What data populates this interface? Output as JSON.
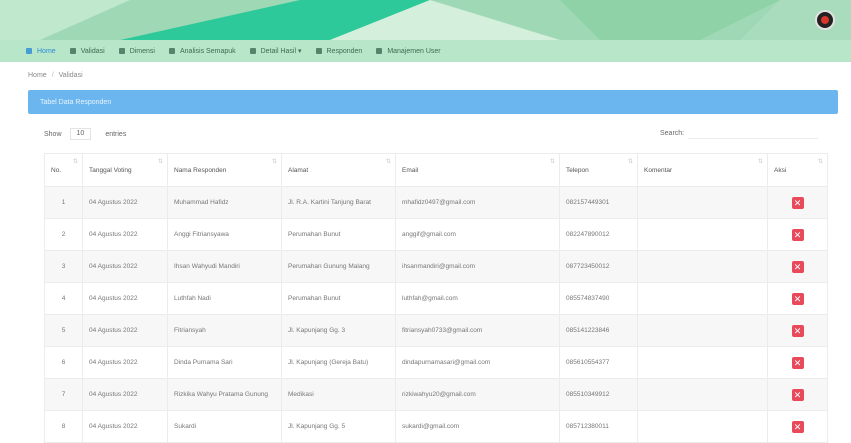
{
  "nav": {
    "items": [
      {
        "label": "Home",
        "icon": "home-icon",
        "active": true
      },
      {
        "label": "Validasi",
        "icon": "list-icon"
      },
      {
        "label": "Dimensi",
        "icon": "grid-icon"
      },
      {
        "label": "Analisis Semapuk",
        "icon": "chart-icon"
      },
      {
        "label": "Detail Hasil",
        "icon": "table-icon"
      },
      {
        "label": "Responden",
        "icon": "users-icon"
      },
      {
        "label": "Manajemen User",
        "icon": "user-icon"
      }
    ]
  },
  "breadcrumb": {
    "home": "Home",
    "current": "Validasi"
  },
  "panel": {
    "title": "Tabel Data Responden"
  },
  "controls": {
    "show_label": "Show",
    "entries_value": "10",
    "entries_label": "entries",
    "search_label": "Search:"
  },
  "table": {
    "headers": [
      "No.",
      "Tanggal Voting",
      "Nama Responden",
      "Alamat",
      "Email",
      "Telepon",
      "Komentar",
      "Aksi"
    ],
    "rows": [
      {
        "no": "1",
        "tanggal": "04 Agustus 2022",
        "nama": "Muhammad Hafidz",
        "alamat": "Jl. R.A. Kartini Tanjung Barat",
        "email": "mhafidz0497@gmail.com",
        "telepon": "082157449301",
        "komentar": ""
      },
      {
        "no": "2",
        "tanggal": "04 Agustus 2022",
        "nama": "Anggi Fitriansyawa",
        "alamat": "Perumahan Bunut",
        "email": "anggif@gmail.com",
        "telepon": "082247890012",
        "komentar": ""
      },
      {
        "no": "3",
        "tanggal": "04 Agustus 2022",
        "nama": "Ihsan Wahyudi Mandiri",
        "alamat": "Perumahan Gunung Malang",
        "email": "ihsanmandiri@gmail.com",
        "telepon": "087723450012",
        "komentar": ""
      },
      {
        "no": "4",
        "tanggal": "04 Agustus 2022",
        "nama": "Luthfah Nadi",
        "alamat": "Perumahan Bunut",
        "email": "luthfah@gmail.com",
        "telepon": "085574837490",
        "komentar": ""
      },
      {
        "no": "5",
        "tanggal": "04 Agustus 2022",
        "nama": "Fitriansyah",
        "alamat": "Jl. Kapunjang Gg. 3",
        "email": "fitriansyah0733@gmail.com",
        "telepon": "085141223846",
        "komentar": ""
      },
      {
        "no": "6",
        "tanggal": "04 Agustus 2022",
        "nama": "Dinda Purnama Sari",
        "alamat": "Jl. Kapunjang (Gereja Batu)",
        "email": "dindapurnamasari@gmail.com",
        "telepon": "085610554377",
        "komentar": ""
      },
      {
        "no": "7",
        "tanggal": "04 Agustus 2022",
        "nama": "Rizkika Wahyu Pratama Gunung",
        "alamat": "Medikasi",
        "email": "rizkiwahyu20@gmail.com",
        "telepon": "085510349912",
        "komentar": ""
      },
      {
        "no": "8",
        "tanggal": "04 Agustus 2022",
        "nama": "Sukardi",
        "alamat": "Jl. Kapunjang Gg. 5",
        "email": "sukardi@gmail.com",
        "telepon": "085712380011",
        "komentar": ""
      }
    ]
  },
  "colors": {
    "banner": "#9fd8b5",
    "navbar": "#b8e6c8",
    "panel_header": "#6cb6ef",
    "delete_button": "#e84a5a"
  }
}
